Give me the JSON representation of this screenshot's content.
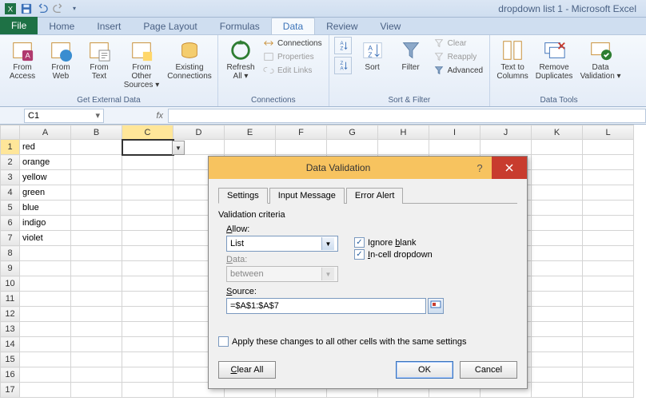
{
  "title": "dropdown list 1 - Microsoft Excel",
  "tabs": {
    "file": "File",
    "home": "Home",
    "insert": "Insert",
    "page_layout": "Page Layout",
    "formulas": "Formulas",
    "data": "Data",
    "review": "Review",
    "view": "View"
  },
  "ribbon": {
    "get_external": {
      "label": "Get External Data",
      "access": "From\nAccess",
      "web": "From\nWeb",
      "text": "From\nText",
      "other": "From Other\nSources ▾",
      "existing": "Existing\nConnections"
    },
    "connections": {
      "label": "Connections",
      "refresh": "Refresh\nAll ▾",
      "conn": "Connections",
      "prop": "Properties",
      "edit": "Edit Links"
    },
    "sort_filter": {
      "label": "Sort & Filter",
      "sort": "Sort",
      "filter": "Filter",
      "clear": "Clear",
      "reapply": "Reapply",
      "advanced": "Advanced"
    },
    "data_tools": {
      "label": "Data Tools",
      "ttc": "Text to\nColumns",
      "dup": "Remove\nDuplicates",
      "dv": "Data\nValidation ▾"
    }
  },
  "name_box": "C1",
  "fx_label": "fx",
  "columns": [
    "A",
    "B",
    "C",
    "D",
    "E",
    "F",
    "G",
    "H",
    "I",
    "J",
    "K",
    "L"
  ],
  "rows": [
    "1",
    "2",
    "3",
    "4",
    "5",
    "6",
    "7",
    "8",
    "9",
    "10",
    "11",
    "12",
    "13",
    "14",
    "15",
    "16",
    "17"
  ],
  "cells": {
    "A1": "red",
    "A2": "orange",
    "A3": "yellow",
    "A4": "green",
    "A5": "blue",
    "A6": "indigo",
    "A7": "violet"
  },
  "selected_cell": "C1",
  "dialog": {
    "title": "Data Validation",
    "tabs": {
      "settings": "Settings",
      "input_msg": "Input Message",
      "error": "Error Alert"
    },
    "criteria_label": "Validation criteria",
    "allow_label": "Allow:",
    "allow_value": "List",
    "data_label": "Data:",
    "data_value": "between",
    "ignore_blank": "Ignore blank",
    "in_cell_dd": "In-cell dropdown",
    "source_label": "Source:",
    "source_value": "=$A$1:$A$7",
    "apply_all": "Apply these changes to all other cells with the same settings",
    "clear_all": "Clear All",
    "ok": "OK",
    "cancel": "Cancel"
  }
}
